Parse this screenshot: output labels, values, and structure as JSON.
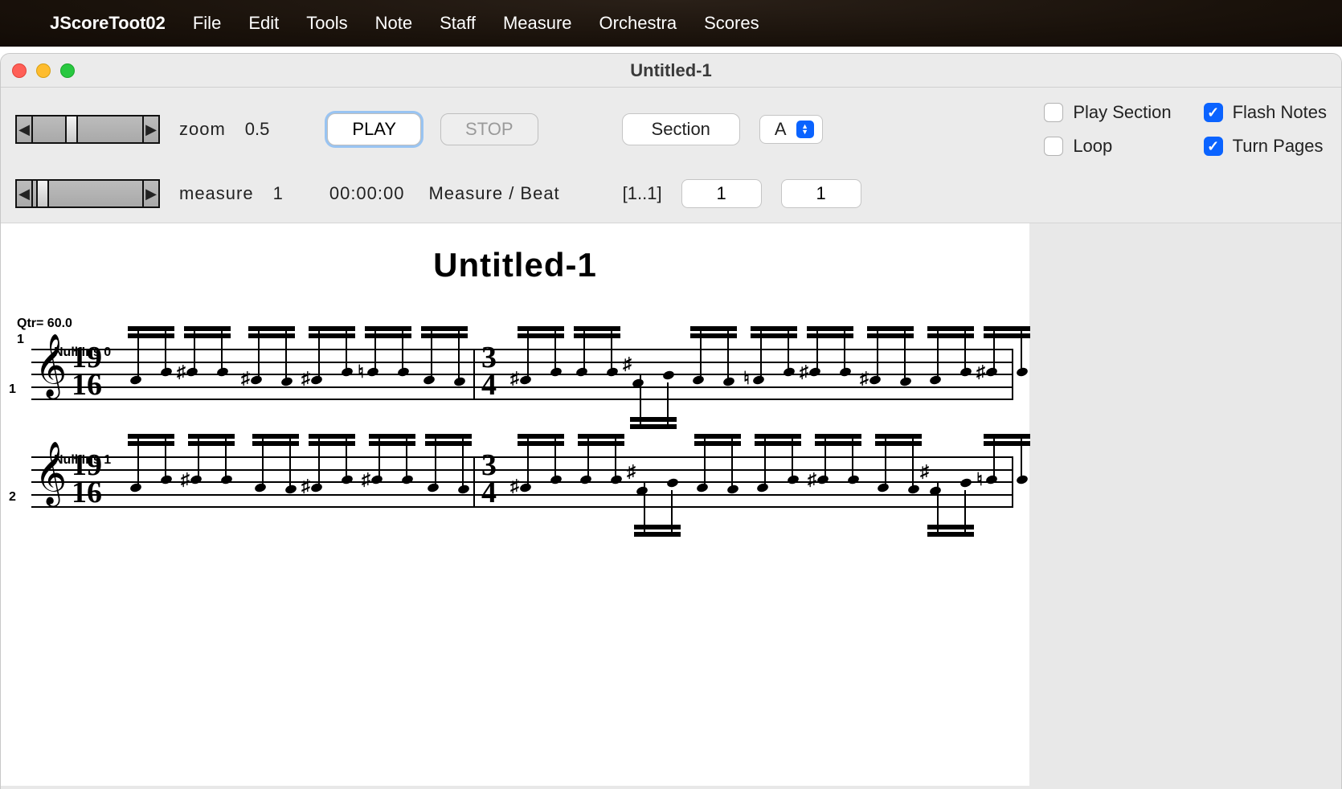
{
  "menubar": {
    "appname": "JScoreToot02",
    "items": [
      "File",
      "Edit",
      "Tools",
      "Note",
      "Staff",
      "Measure",
      "Orchestra",
      "Scores"
    ]
  },
  "window": {
    "title": "Untitled-1"
  },
  "toolbar": {
    "zoom_label": "zoom",
    "zoom_value": "0.5",
    "play_label": "PLAY",
    "stop_label": "STOP",
    "section_label": "Section",
    "section_selected": "A",
    "measure_label": "measure",
    "measure_value": "1",
    "time_display": "00:00:00",
    "measure_beat_label": "Measure / Beat",
    "range_label": "[1..1]",
    "range_from": "1",
    "range_to": "1",
    "checks": {
      "play_section": {
        "label": "Play Section",
        "checked": false
      },
      "flash_notes": {
        "label": "Flash Notes",
        "checked": true
      },
      "loop": {
        "label": "Loop",
        "checked": false
      },
      "turn_pages": {
        "label": "Turn Pages",
        "checked": true
      }
    }
  },
  "score": {
    "title": "Untitled-1",
    "tempo_label": "Qtr= 60.0",
    "start_bar": "1",
    "time_sig_a": {
      "num": "19",
      "den": "16"
    },
    "time_sig_b": {
      "num": "3",
      "den": "4"
    },
    "staves": [
      {
        "number": "1",
        "instrument": "Null Ins 0"
      },
      {
        "number": "2",
        "instrument": "Null Ins 1"
      }
    ]
  }
}
